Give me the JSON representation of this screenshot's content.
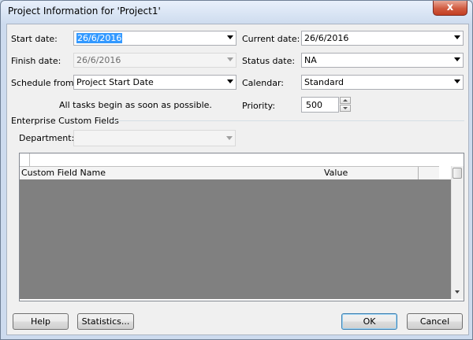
{
  "window": {
    "title": "Project Information for 'Project1'",
    "close_label": "x"
  },
  "fields": {
    "start_date_label": "Start date:",
    "start_date_value": "26/6/2016",
    "finish_date_label": "Finish date:",
    "finish_date_value": "26/6/2016",
    "schedule_from_label": "Schedule from:",
    "schedule_from_value": "Project Start Date",
    "schedule_note": "All tasks begin as soon as possible.",
    "current_date_label": "Current date:",
    "current_date_value": "26/6/2016",
    "status_date_label": "Status date:",
    "status_date_value": "NA",
    "calendar_label": "Calendar:",
    "calendar_value": "Standard",
    "priority_label": "Priority:",
    "priority_value": "500"
  },
  "enterprise": {
    "section_label": "Enterprise Custom Fields",
    "department_label": "Department:",
    "department_value": "",
    "columns": [
      "Custom Field Name",
      "Value"
    ]
  },
  "buttons": {
    "help": "Help",
    "statistics": "Statistics...",
    "ok": "OK",
    "cancel": "Cancel"
  },
  "colors": {
    "selection": "#3399ff",
    "close_button": "#c94a2e",
    "grid_body": "#808080"
  }
}
